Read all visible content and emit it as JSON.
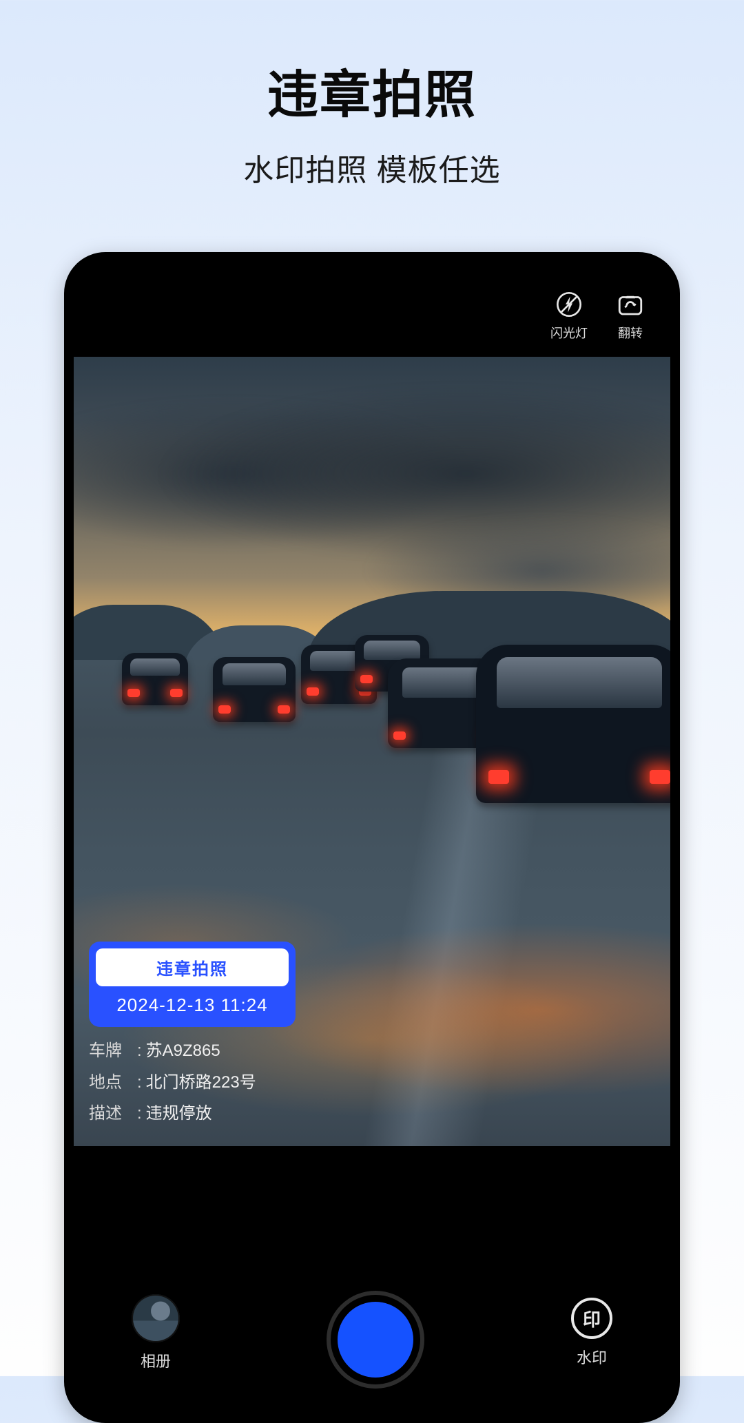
{
  "hero": {
    "title": "违章拍照",
    "subtitle": "水印拍照 模板任选"
  },
  "topbar": {
    "flash_label": "闪光灯",
    "flip_label": "翻转"
  },
  "watermark": {
    "title": "违章拍照",
    "timestamp": "2024-12-13 11:24",
    "plate_label": "车牌",
    "plate_value": "苏A9Z865",
    "location_label": "地点",
    "location_value": "北门桥路223号",
    "desc_label": "描述",
    "desc_value": "违规停放"
  },
  "bottombar": {
    "album_label": "相册",
    "watermark_label": "水印",
    "stamp_glyph": "印"
  },
  "colors": {
    "accent": "#1552ff",
    "wm_bg": "#2951ff"
  }
}
